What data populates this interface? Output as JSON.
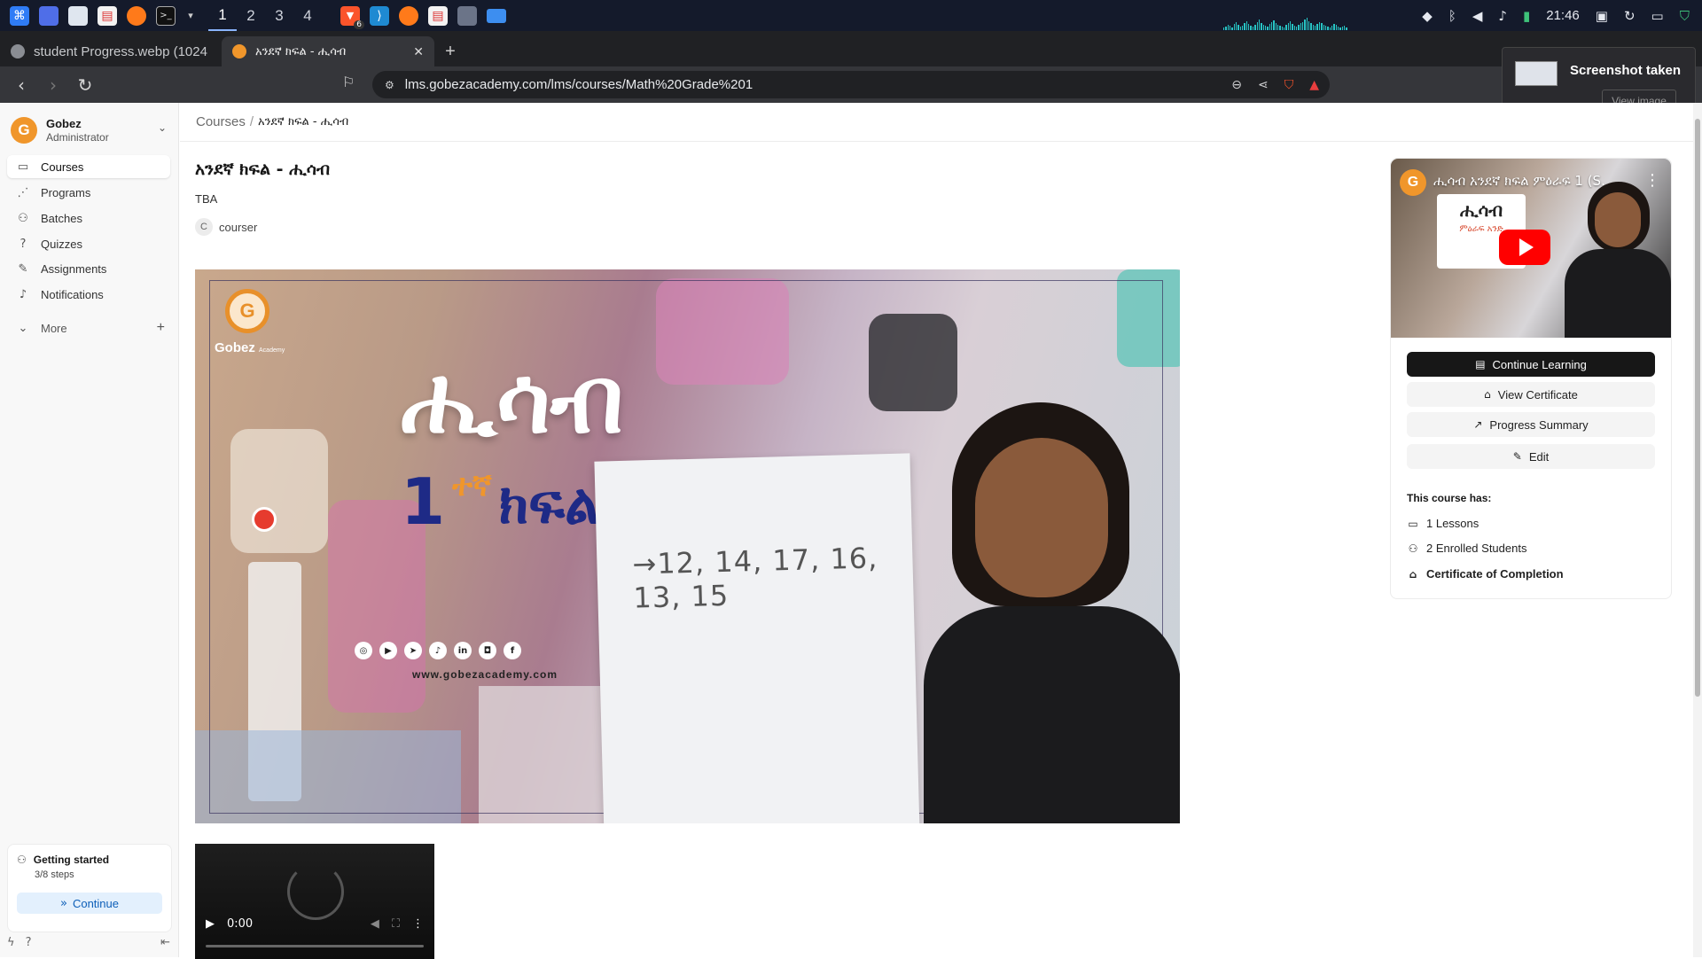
{
  "os_panel": {
    "workspaces": [
      "1",
      "2",
      "3",
      "4"
    ],
    "active_workspace": "1",
    "brave_badge": "6",
    "clock": "21:46",
    "app_icons": [
      "app-menu-icon",
      "desktop-icon",
      "file-manager-icon",
      "pdf-icon",
      "firefox-icon",
      "terminal-icon",
      "chevron-down-icon"
    ],
    "pinned_icons": [
      "brave-icon",
      "vscode-icon",
      "firefox-icon",
      "pdf-icon",
      "document-icon",
      "folder-icon"
    ],
    "tray_icons": [
      "wifi-icon",
      "bluetooth-icon",
      "volume-icon",
      "bell-icon",
      "battery-icon",
      "lock-icon",
      "refresh-icon",
      "terminal-icon",
      "shield-icon"
    ]
  },
  "browser": {
    "tabs": [
      {
        "title": "student Progress.webp (1024",
        "active": false
      },
      {
        "title": "አንደኛ ክፍል - ሒሳብ",
        "active": true
      }
    ],
    "url": "lms.gobezacademy.com/lms/courses/Math%20Grade%201"
  },
  "notification": {
    "title": "Screenshot taken",
    "button": "View image"
  },
  "sidebar": {
    "org_name": "Gobez",
    "org_role": "Administrator",
    "items": [
      {
        "label": "Courses",
        "icon": "book-icon",
        "glyph": "▭",
        "active": true
      },
      {
        "label": "Programs",
        "icon": "route-icon",
        "glyph": "⋰",
        "active": false
      },
      {
        "label": "Batches",
        "icon": "users-icon",
        "glyph": "⚇",
        "active": false
      },
      {
        "label": "Quizzes",
        "icon": "help-circle-icon",
        "glyph": "?",
        "active": false
      },
      {
        "label": "Assignments",
        "icon": "pencil-icon",
        "glyph": "✎",
        "active": false
      },
      {
        "label": "Notifications",
        "icon": "bell-icon",
        "glyph": "♪",
        "active": false
      }
    ],
    "more_label": "More",
    "getting_started": {
      "title": "Getting started",
      "steps": "3/8 steps",
      "button": "Continue"
    }
  },
  "breadcrumb": {
    "root": "Courses",
    "current": "አንደኛ ክፍል - ሒሳብ"
  },
  "course": {
    "title": "አንደኛ ክፍል - ሒሳብ",
    "short_intro": "TBA",
    "author_initial": "C",
    "author": "courser"
  },
  "banner": {
    "logo_letter": "G",
    "brand": "Gobez",
    "brand_sub": "Academy",
    "title": "ሒሳብ",
    "grade_number": "1",
    "grade_suffix": "ተኛ",
    "grade_word": "ክፍል",
    "sequence": "→12, 14, 17, 16, 13, 15",
    "social_icons": [
      "globe-icon",
      "youtube-icon",
      "telegram-icon",
      "tiktok-icon",
      "linkedin-icon",
      "instagram-icon",
      "facebook-icon"
    ],
    "website": "www.gobezacademy.com"
  },
  "video_player": {
    "time": "0:00"
  },
  "card": {
    "video_title": "ሒሳብ አንደኛ ክፍል ምዕራፍ 1 (S...",
    "video_board_title": "ሒሳብ",
    "video_board_sub": "ምዕራፍ አንድ",
    "buttons": {
      "continue_learning": "Continue Learning",
      "view_certificate": "View Certificate",
      "progress_summary": "Progress Summary",
      "edit": "Edit"
    },
    "course_has_label": "This course has:",
    "lessons": "1 Lessons",
    "students": "2 Enrolled Students",
    "certificate": "Certificate of Completion"
  },
  "colors": {
    "brand_orange": "#f0962b",
    "primary_button": "#171717",
    "continue_blue": "#0d5fb8",
    "title_navy": "#1e2a86"
  }
}
